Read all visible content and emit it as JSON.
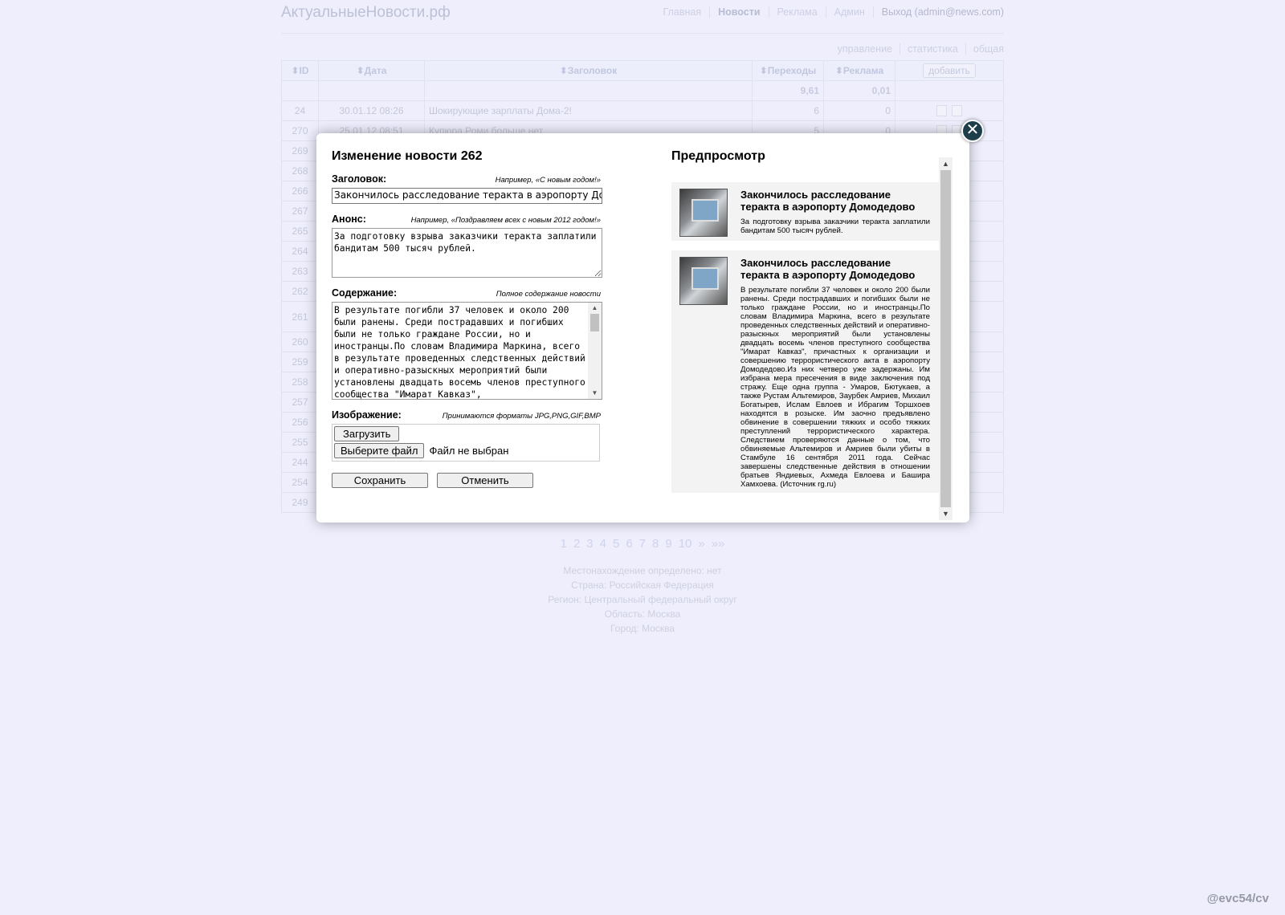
{
  "site": {
    "title": "АктуальныеНовости.рф",
    "nav": [
      "Главная",
      "Новости",
      "Реклама",
      "Админ"
    ],
    "nav_active": "Новости",
    "logout": "Выход (admin@news.com)",
    "subnav": [
      "управление",
      "статистика",
      "общая"
    ]
  },
  "table": {
    "headers": {
      "id": "ID",
      "date": "Дата",
      "title": "Заголовок",
      "clicks": "Переходы",
      "ads": "Реклама",
      "add": "добавить"
    },
    "sort_icon": "⬍",
    "totals": {
      "clicks": "9,61",
      "ads": "0,01"
    },
    "rows": [
      {
        "id": "24",
        "date": "30.01.12 08:26",
        "title": "Шокирующие зарплаты Дома-2!",
        "clicks": "6",
        "ads": "0"
      },
      {
        "id": "270",
        "date": "25.01.12 08:51",
        "title": "Купюра Роми больше нет",
        "clicks": "5",
        "ads": "0"
      },
      {
        "id": "269"
      },
      {
        "id": "268"
      },
      {
        "id": "266"
      },
      {
        "id": "267"
      },
      {
        "id": "265"
      },
      {
        "id": "264"
      },
      {
        "id": "263"
      },
      {
        "id": "262"
      },
      {
        "id": "261"
      },
      {
        "id": "260"
      },
      {
        "id": "259"
      },
      {
        "id": "258"
      },
      {
        "id": "257"
      },
      {
        "id": "256"
      },
      {
        "id": "255"
      },
      {
        "id": "244"
      },
      {
        "id": "254"
      },
      {
        "id": "249"
      }
    ]
  },
  "pager": [
    "1",
    "2",
    "3",
    "4",
    "5",
    "6",
    "7",
    "8",
    "9",
    "10",
    "»",
    "»»"
  ],
  "geo": [
    "Местонахождение определено: нет",
    "Страна: Российская Федерация",
    "Регион: Центральный федеральный округ",
    "Область: Москва",
    "Город: Москва"
  ],
  "credit": "@evc54/cv",
  "modal": {
    "close_glyph": "✕",
    "title": "Изменение новости 262",
    "headline_label": "Заголовок:",
    "headline_hint": "Например, «С новым годом!»",
    "headline_value": "Закончилось расследование теракта в аэропорту Домодедово",
    "teaser_label": "Анонс:",
    "teaser_hint": "Например, «Поздравляем всех с новым 2012 годом!»",
    "teaser_value": "За подготовку взрыва заказчики теракта заплатили бандитам 500 тысяч рублей.",
    "content_label": "Содержание:",
    "content_hint": "Полное содержание новости",
    "content_value": "В результате погибли 37 человек и около 200 были ранены. Среди пострадавших и погибших были не только граждане России, но и иностранцы.По словам Владимира Маркина, всего в результате проведенных следственных действий и оперативно-разыскных мероприятий были установлены двадцать восемь членов преступного сообщества \"Имарат Кавказ\",",
    "image_label": "Изображение:",
    "image_hint": "Принимаются форматы JPG,PNG,GIF,BMP",
    "upload_button": "Загрузить",
    "choose_file_button": "Выберите файл",
    "no_file_text": "Файл не выбран",
    "save_button": "Сохранить",
    "cancel_button": "Отменить",
    "scroll_up": "▲",
    "scroll_down": "▼"
  },
  "preview": {
    "title": "Предпросмотр",
    "card_title": "Закончилось расследование теракта в аэропорту Домодедово",
    "card_teaser": "За подготовку взрыва заказчики теракта заплатили бандитам 500 тысяч рублей.",
    "card_full": "В результате погибли 37 человек и около 200 были ранены. Среди пострадавших и погибших были не только граждане России, но и иностранцы.По словам Владимира Маркина, всего в результате проведенных следственных действий и оперативно-разыскных мероприятий были установлены двадцать восемь членов преступного сообщества \"Имарат Кавказ\", причастных к организации и совершению террористического акта в аэропорту Домодедово.Из них четверо уже задержаны. Им избрана мера пресечения в виде заключения под стражу. Еще одна группа - Умаров, Бютукаев, а также Рустам Альтемиров, Заурбек Амриев, Михаил Богатырев, Ислам Евлоев и Ибрагим Торшхоев находятся в розыске. Им заочно предъявлено обвинение в совершении тяжких и особо тяжких преступлений террористического характера. Следствием проверяются данные о том, что обвиняемые Альтемиров и Амриев были убиты в Стамбуле 16 сентября 2011 года. Сейчас завершены следственные действия в отношении братьев Яндиевых, Ахмеда Евлоева и Башира Хамхоева. (Источник rg.ru)",
    "image_icon": "news-photo-icon"
  }
}
